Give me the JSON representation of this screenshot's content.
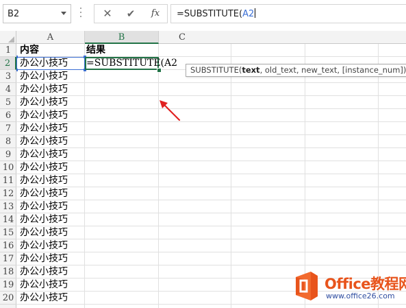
{
  "formula_bar": {
    "name_box": "B2",
    "cancel_symbol": "✕",
    "enter_symbol": "✔",
    "fx_symbol": "fx",
    "formula_prefix": "=SUBSTITUTE(",
    "formula_ref": "A2"
  },
  "columns": [
    "A",
    "B",
    "C"
  ],
  "tooltip": {
    "fn": "SUBSTITUTE(",
    "arg1": "text",
    "rest": ", old_text, new_text, [instance_num])"
  },
  "rows": [
    "1",
    "2",
    "3",
    "4",
    "5",
    "6",
    "7",
    "8",
    "9",
    "10",
    "11",
    "12",
    "13",
    "14",
    "15",
    "16",
    "17",
    "18",
    "19",
    "20"
  ],
  "cells": {
    "a1": "内容",
    "b1": "结果",
    "b2": "=SUBSTITUTE(A2",
    "a_values": [
      "办公小技巧",
      "办公小技巧",
      "办公小技巧",
      "办公小技巧",
      "办公小技巧",
      "办公小技巧",
      "办公小技巧",
      "办公小技巧",
      "办公小技巧",
      "办公小技巧",
      "办公小技巧",
      "办公小技巧",
      "办公小技巧",
      "办公小技巧",
      "办公小技巧",
      "办公小技巧",
      "办公小技巧",
      "办公小技巧",
      "办公小技巧"
    ]
  },
  "watermark": {
    "title": "Office教程网",
    "url": "www.office26.com"
  },
  "colors": {
    "excel_green": "#217346",
    "ref_blue": "#3b6fd4",
    "arrow_red": "#e02020",
    "watermark_orange": "#e8541c"
  }
}
